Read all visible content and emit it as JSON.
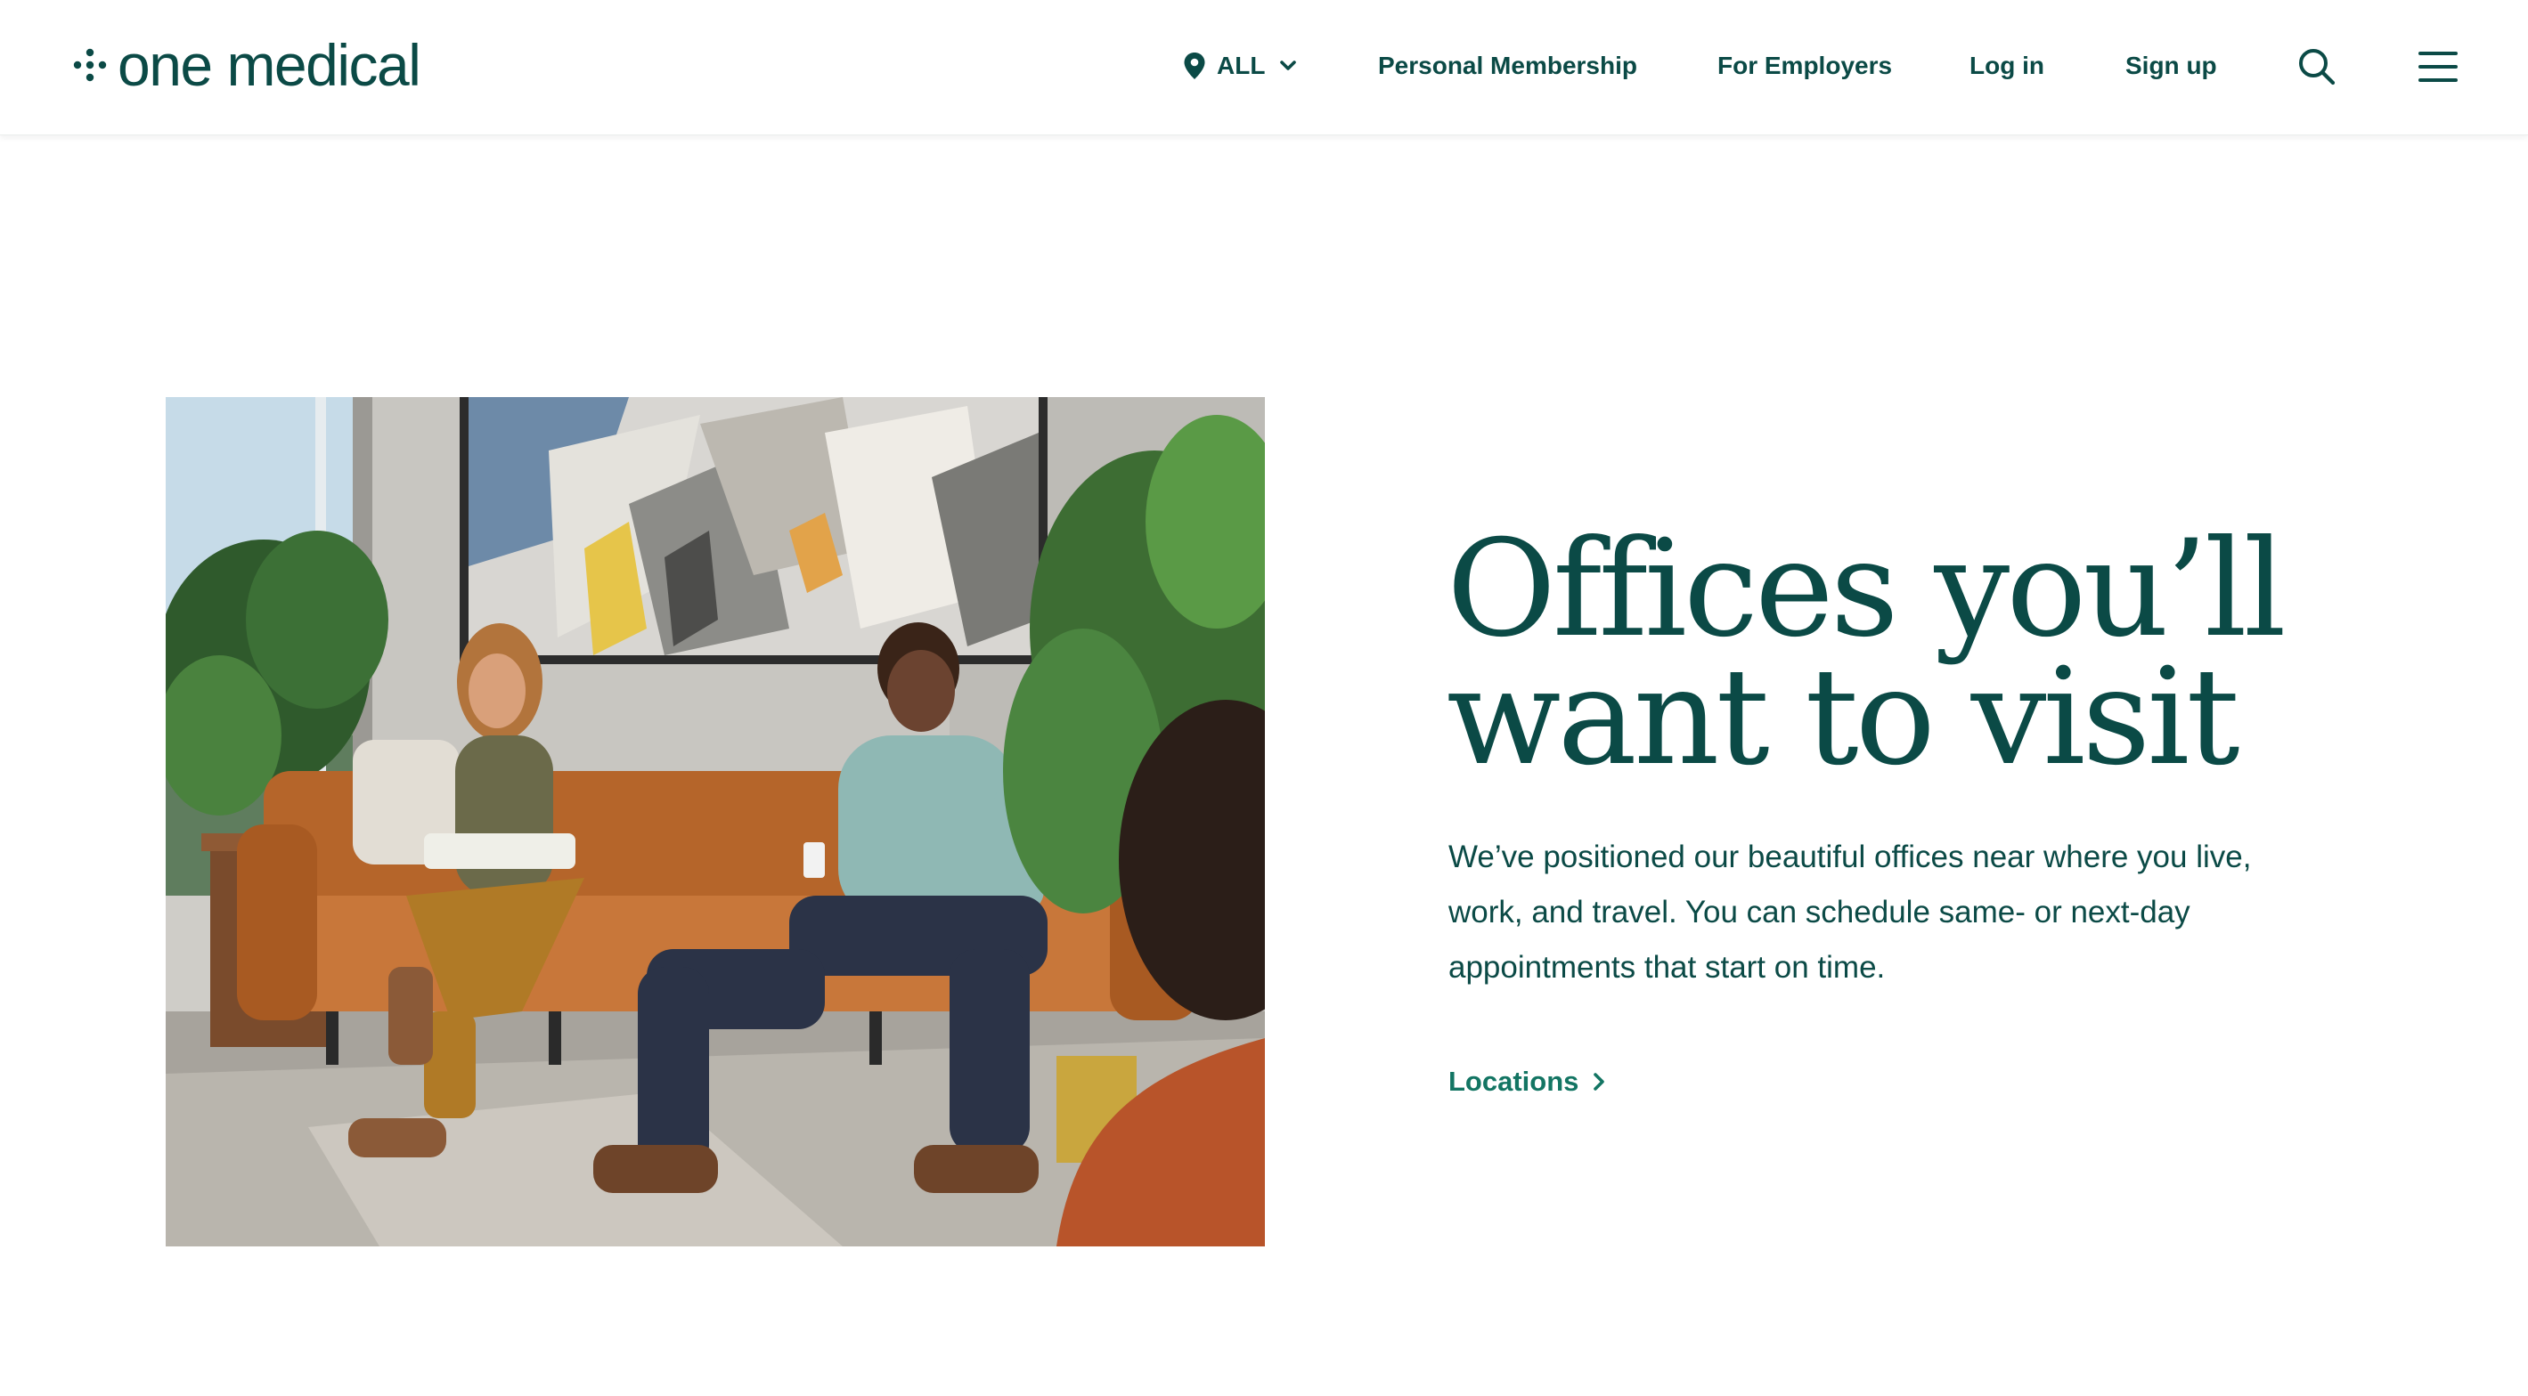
{
  "header": {
    "logo_text": "one medical",
    "location": {
      "label": "ALL",
      "icon": "map-pin-icon",
      "chevron": "chevron-down-icon"
    },
    "nav": [
      {
        "label": "Personal Membership"
      },
      {
        "label": "For Employers"
      },
      {
        "label": "Log in"
      },
      {
        "label": "Sign up"
      }
    ],
    "search_icon": "search-icon",
    "menu_icon": "hamburger-menu-icon"
  },
  "hero": {
    "image_alt": "Patients waiting on a leather sofa in a One Medical office",
    "headline": [
      "Offices you’ll",
      "want to visit"
    ],
    "body": [
      "We’ve positioned our beautiful offices near where you live,",
      "work, and travel. You can schedule same- or next-day",
      "appointments that start on time."
    ],
    "link_label": "Locations",
    "link_icon": "chevron-right-icon"
  },
  "colors": {
    "brand": "#0b4a46",
    "link": "#137563",
    "background": "#ffffff"
  }
}
